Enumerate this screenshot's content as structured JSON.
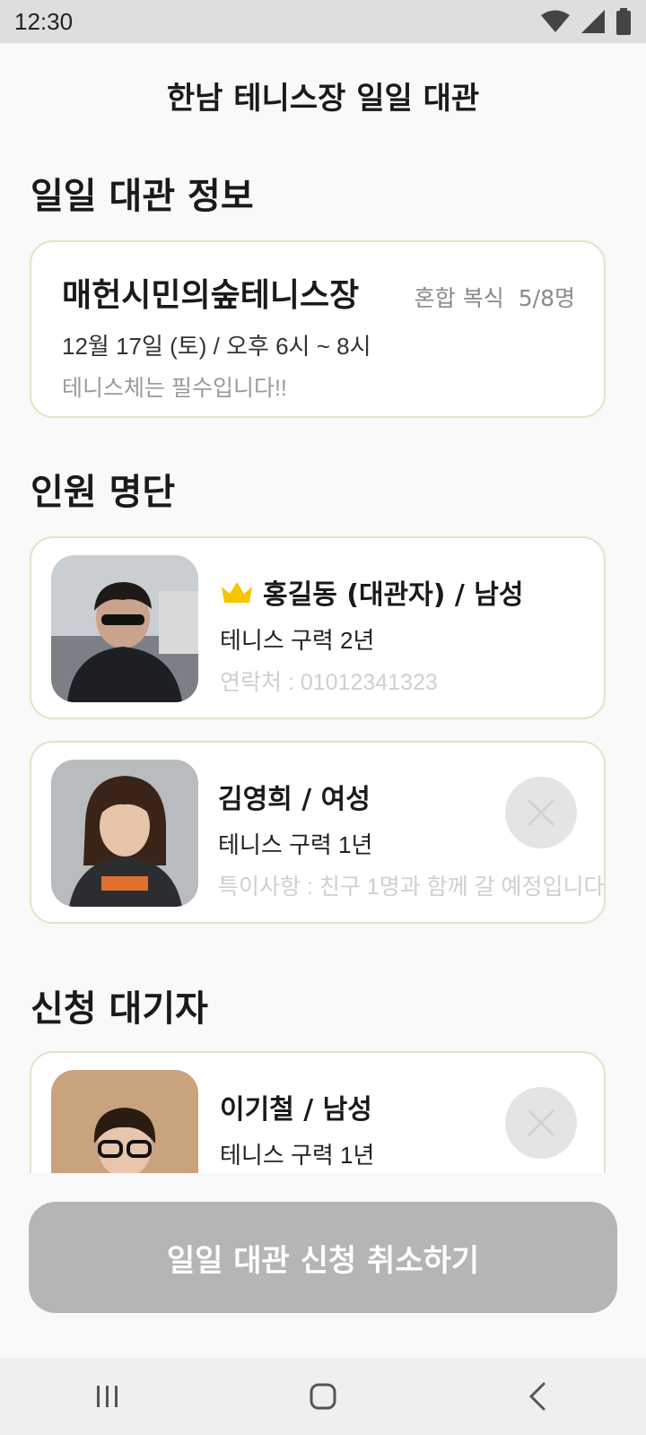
{
  "status_bar": {
    "time": "12:30"
  },
  "header": {
    "title": "한남 테니스장 일일 대관"
  },
  "sections": {
    "info": "일일 대관 정보",
    "members": "인원 명단",
    "waitlist": "신청 대기자"
  },
  "rental": {
    "venue": "매헌시민의숲테니스장",
    "game_type": "혼합 복식",
    "capacity": "5/8명",
    "datetime": "12월 17일 (토) / 오후 6시 ~ 8시",
    "note": "테니스체는 필수입니다!!"
  },
  "members": [
    {
      "name": "홍길동 (대관자) / 남성",
      "experience": "테니스 구력 2년",
      "extra": "연락처 :  01012341323",
      "is_host": true,
      "icon": "crown-icon"
    },
    {
      "name": "김영희 / 여성",
      "experience": "테니스 구력 1년",
      "extra": "특이사항 : 친구 1명과 함께 갈 예정입니다",
      "is_host": false
    }
  ],
  "waitlist": [
    {
      "name": "이기철 / 남성",
      "experience": "테니스 구력 1년"
    }
  ],
  "actions": {
    "cancel_label": "일일 대관 신청 취소하기"
  },
  "colors": {
    "card_border": "#dfe6c4",
    "crown": "#f6c500",
    "button_disabled": "#b5b5b5"
  }
}
